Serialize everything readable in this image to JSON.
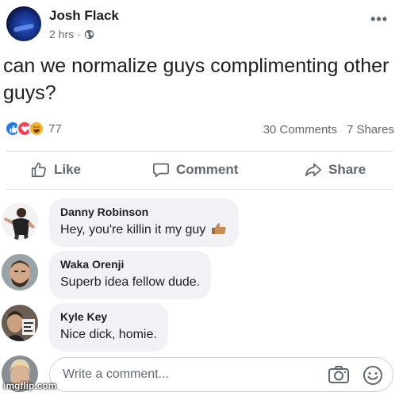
{
  "post": {
    "author": "Josh Flack",
    "time": "2 hrs",
    "separator": "·",
    "text": "can we normalize guys complimenting other guys?",
    "reactions_count": "77",
    "comments_count": "30 Comments",
    "shares_count": "7 Shares",
    "reaction_icons": [
      "like-icon",
      "love-icon",
      "haha-icon"
    ]
  },
  "actions": {
    "like": "Like",
    "comment": "Comment",
    "share": "Share"
  },
  "comments": [
    {
      "name": "Danny Robinson",
      "text": "Hey, you're killin it my guy"
    },
    {
      "name": "Waka Orenji",
      "text": "Superb idea fellow dude."
    },
    {
      "name": "Kyle Key",
      "text": "Nice dick, homie."
    }
  ],
  "composer": {
    "placeholder": "Write a comment..."
  },
  "watermark": "imgflip.com",
  "colors": {
    "like_blue": "#2078f4",
    "love_red": "#f33e58",
    "haha_yellow": "#f7b125",
    "muted_text": "#606770",
    "bubble_bg": "#f0f2f5"
  }
}
